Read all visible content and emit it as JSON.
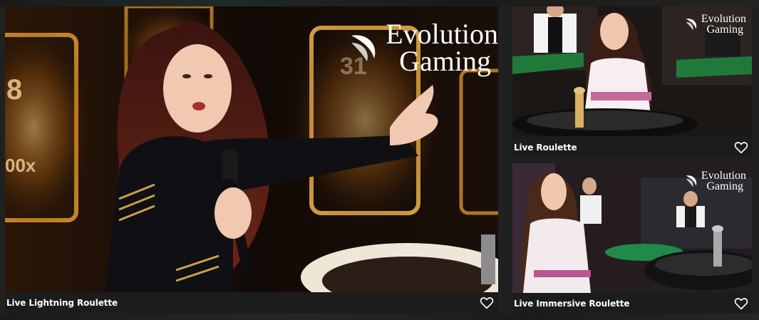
{
  "provider": {
    "name_line1": "Evolution",
    "name_line2": "Gaming"
  },
  "games": [
    {
      "title": "Live Lightning Roulette",
      "favorite_icon": "heart-outline-icon"
    },
    {
      "title": "Live Roulette",
      "favorite_icon": "heart-outline-icon"
    },
    {
      "title": "Live Immersive Roulette",
      "favorite_icon": "heart-outline-icon"
    }
  ],
  "colors": {
    "background": "#202020",
    "caption_bg": "#1c1c1c",
    "text": "#ffffff",
    "table_green": "#1f7a3a",
    "gold": "#e8a43a"
  }
}
